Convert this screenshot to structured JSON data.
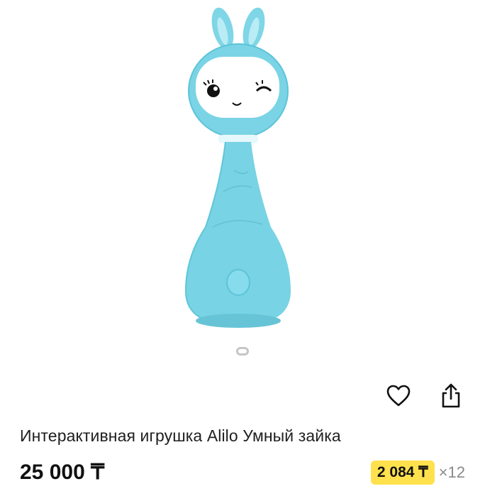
{
  "product": {
    "title": "Интерактивная игрушка Alilo Умный зайка",
    "price": "25 000 ₸",
    "installment": {
      "amount": "2 084 ₸",
      "months": "×12"
    }
  },
  "gallery": {
    "image_subject": "blue-bunny-rattle-toy",
    "active_slide": 1
  },
  "icons": {
    "favorite": "heart-icon",
    "share": "share-icon"
  },
  "colors": {
    "toy_body": "#78d3e4",
    "installment_badge": "#ffe14d",
    "pager_dot": "#c6c6c6"
  }
}
